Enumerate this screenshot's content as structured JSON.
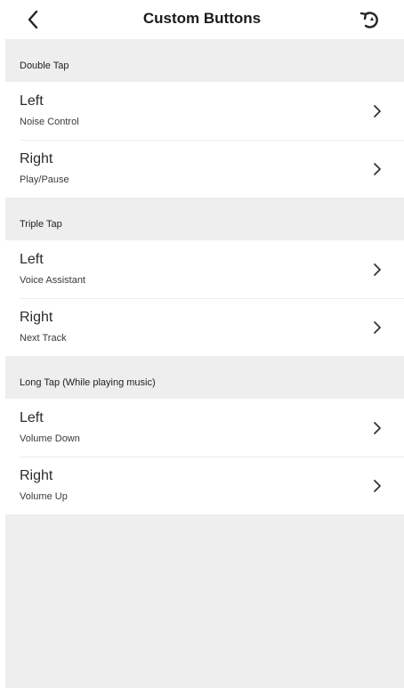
{
  "header": {
    "title": "Custom Buttons",
    "back_icon": "chevron-left-icon",
    "reset_icon": "reset-icon"
  },
  "sections": [
    {
      "title": "Double Tap",
      "rows": [
        {
          "label": "Left",
          "value": "Noise Control"
        },
        {
          "label": "Right",
          "value": "Play/Pause"
        }
      ]
    },
    {
      "title": "Triple Tap",
      "rows": [
        {
          "label": "Left",
          "value": "Voice Assistant"
        },
        {
          "label": "Right",
          "value": "Next Track"
        }
      ]
    },
    {
      "title": "Long Tap (While playing music)",
      "rows": [
        {
          "label": "Left",
          "value": "Volume Down"
        },
        {
          "label": "Right",
          "value": "Volume Up"
        }
      ]
    }
  ],
  "colors": {
    "background": "#eeeeee",
    "row_background": "#ffffff",
    "text": "#222222"
  }
}
